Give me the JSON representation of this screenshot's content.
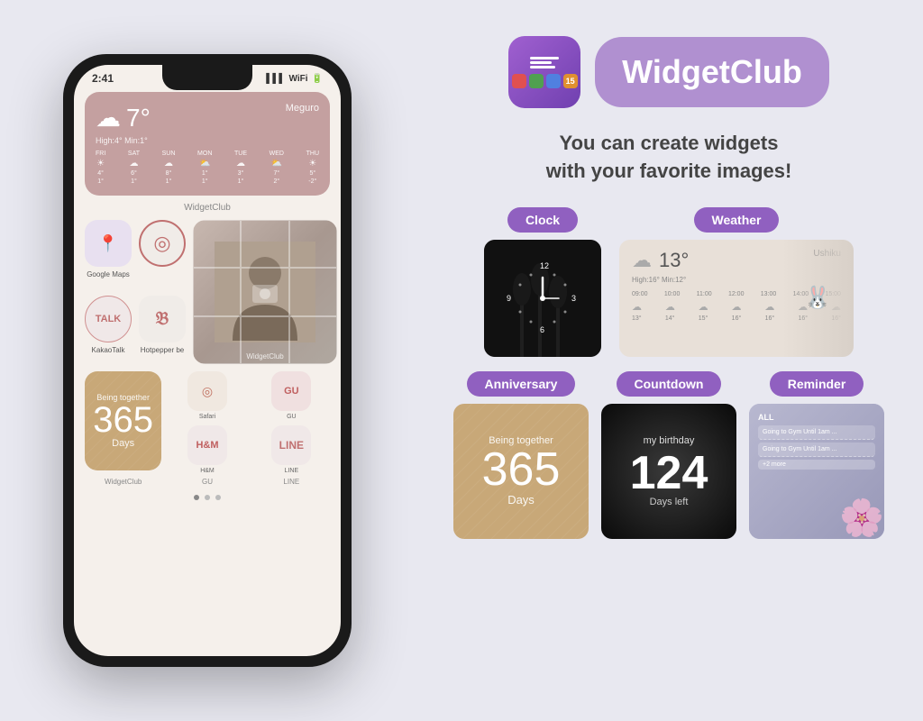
{
  "app": {
    "name": "WidgetClub",
    "tagline_line1": "You can create widgets",
    "tagline_line2": "with your favorite images!"
  },
  "phone": {
    "time": "2:41",
    "weather": {
      "temp": "7°",
      "location": "Meguro",
      "high_low": "High:4° Min:1°",
      "days": [
        "FRI",
        "SAT",
        "SUN",
        "MON",
        "TUE",
        "WED",
        "THU"
      ],
      "icons": [
        "☀",
        "☁",
        "☁",
        "⛅",
        "☁",
        "⛅",
        "☀"
      ],
      "highs": [
        "4°",
        "6°",
        "8°",
        "1°",
        "3°",
        "7°",
        "5°"
      ],
      "lows": [
        "1°",
        "1°",
        "1°",
        "1°",
        "1°",
        "2°",
        "-2°"
      ]
    },
    "widgetclub_label": "WidgetClub",
    "being_together_num": "365",
    "being_together_label": "Days",
    "being_together_text": "Being together",
    "apps": {
      "maps_label": "Google Maps",
      "talk_label": "KakaoTalk",
      "hotpepper_label": "Hotpepper be",
      "widget_label": "WidgetClub",
      "safari_label": "Safari",
      "hm_label": "H&M",
      "gu_label": "GU",
      "line_label": "LINE",
      "widgetclub_label2": "WidgetClub",
      "gu_label2": "GU",
      "line_label2": "LINE"
    }
  },
  "categories": {
    "clock": "Clock",
    "weather": "Weather",
    "anniversary": "Anniversary",
    "countdown": "Countdown",
    "reminder": "Reminder"
  },
  "weather_preview": {
    "temp": "13°",
    "location": "Ushiku",
    "high_low": "High:16° Min:12°",
    "times": [
      "09:00",
      "10:00",
      "11:00",
      "12:00",
      "13:00",
      "14:00",
      "15:00"
    ],
    "temps": [
      "13°",
      "14°",
      "15°",
      "16°",
      "16°",
      "16°",
      "16°"
    ]
  },
  "anniversary_preview": {
    "being_text": "Being together",
    "num": "365",
    "days_label": "Days"
  },
  "countdown_preview": {
    "title": "my birthday",
    "num": "124",
    "label": "Days left"
  },
  "reminder_preview": {
    "all_label": "ALL",
    "items": [
      "Going to Gym Until 1am ...",
      "Going to Gym Until 1am ..."
    ],
    "more": "+2 more"
  }
}
